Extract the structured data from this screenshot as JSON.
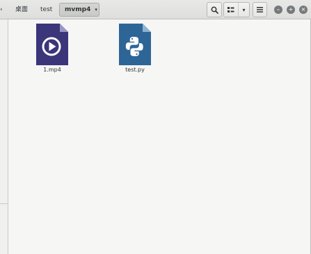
{
  "header": {
    "back_arrow": "‹",
    "breadcrumbs": [
      {
        "label": "桌面"
      },
      {
        "label": "test"
      },
      {
        "label": "mvmp4"
      }
    ],
    "active_caret": "▾",
    "search_icon": "search-icon",
    "view_icon": "icon-view-grid",
    "view_dropdown": "▾",
    "menu_icon": "hamburger-icon"
  },
  "window_controls": {
    "minimize": "–",
    "maximize": "+",
    "close": "×"
  },
  "files": [
    {
      "name": "1.mp4",
      "icon": "video-file-icon",
      "color": "#3f3a7f"
    },
    {
      "name": "test.py",
      "icon": "python-file-icon",
      "color": "#2f6598"
    }
  ]
}
